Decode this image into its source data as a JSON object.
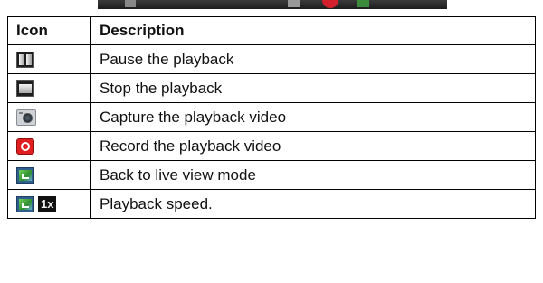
{
  "table": {
    "headers": {
      "icon": "Icon",
      "description": "Description"
    },
    "rows": [
      {
        "icon": "pause-icon",
        "description": "Pause the playback"
      },
      {
        "icon": "stop-icon",
        "description": "Stop the playback"
      },
      {
        "icon": "camera-icon",
        "description": "Capture the playback video"
      },
      {
        "icon": "record-icon",
        "description": "Record the playback video"
      },
      {
        "icon": "live-view-icon",
        "description": "Back to live view mode"
      },
      {
        "icon": "live-view-icon",
        "speed_label": "1x",
        "description": "Playback speed."
      }
    ]
  },
  "colors": {
    "record_red": "#e02020",
    "toolbar_dark": "#1c1c1c",
    "border": "#000000"
  }
}
